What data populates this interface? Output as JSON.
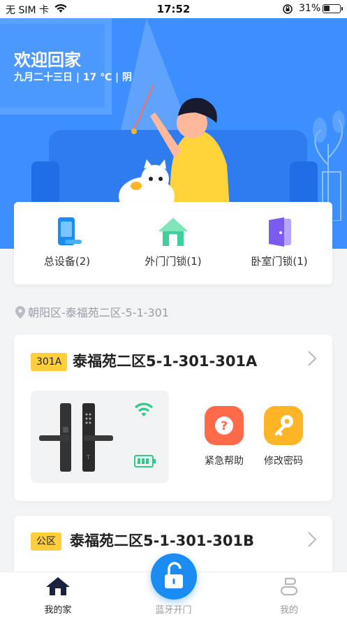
{
  "status_bar": {
    "carrier": "无 SIM 卡",
    "time": "17:52",
    "battery": "31%",
    "battery_level": 0.31
  },
  "hero": {
    "title": "欢迎回家",
    "subtitle": "九月二十三日 | 17 ℃ | 阴"
  },
  "devices": {
    "items": [
      {
        "label": "总设备(2)",
        "icon": "phone-device-icon",
        "color": "#1a8cf5"
      },
      {
        "label": "外门门锁(1)",
        "icon": "house-icon",
        "color": "#3fcf9a"
      },
      {
        "label": "卧室门锁(1)",
        "icon": "door-icon",
        "color": "#7c5cf0"
      }
    ]
  },
  "address": "朝阳区-泰福苑二区-5-1-301",
  "rooms": [
    {
      "tag": "301A",
      "name": "泰福苑二区5-1-301-301A",
      "wifi_icon": "wifi-icon",
      "battery_icon": "battery-icon",
      "actions": [
        {
          "label": "紧急帮助",
          "icon": "question-icon",
          "color": "#ff6a48"
        },
        {
          "label": "修改密码",
          "icon": "key-icon",
          "color": "#ffb526"
        }
      ]
    },
    {
      "tag": "公区",
      "name": "泰福苑二区5-1-301-301B"
    }
  ],
  "tabbar": {
    "home": "我的家",
    "bluetooth": "蓝牙开门",
    "mine": "我的"
  },
  "colors": {
    "accent": "#1b8cf3",
    "hero_bg": "#3d8fff",
    "tag_yellow": "#ffce3a",
    "status_green": "#2ecc8a"
  }
}
